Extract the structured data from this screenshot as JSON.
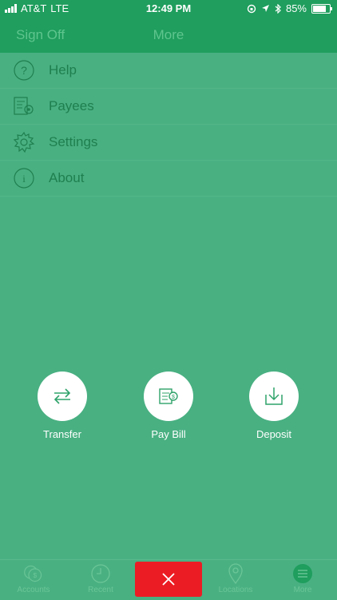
{
  "status_bar": {
    "carrier": "AT&T",
    "network": "LTE",
    "time": "12:49 PM",
    "battery": "85%"
  },
  "navbar": {
    "left": "Sign Off",
    "title": "More"
  },
  "menu": {
    "items": [
      {
        "label": "Help",
        "icon": "help-circle-icon"
      },
      {
        "label": "Payees",
        "icon": "payees-icon"
      },
      {
        "label": "Settings",
        "icon": "gear-icon"
      },
      {
        "label": "About",
        "icon": "info-circle-icon"
      }
    ]
  },
  "actions": [
    {
      "label": "Transfer",
      "icon": "transfer-arrows-icon"
    },
    {
      "label": "Pay Bill",
      "icon": "pay-bill-icon"
    },
    {
      "label": "Deposit",
      "icon": "deposit-download-icon"
    }
  ],
  "tabbar": {
    "tabs": [
      {
        "label": "Accounts",
        "icon": "accounts-coins-icon"
      },
      {
        "label": "Recent",
        "icon": "clock-icon"
      },
      {
        "label": "Locations",
        "icon": "location-pin-icon"
      },
      {
        "label": "More",
        "icon": "menu-lines-icon"
      }
    ],
    "close_icon": "close-icon"
  },
  "colors": {
    "primary": "#1f9e5d",
    "overlay": "#49b082",
    "text_dark": "#1f7f4e",
    "close": "#ec1c24"
  }
}
